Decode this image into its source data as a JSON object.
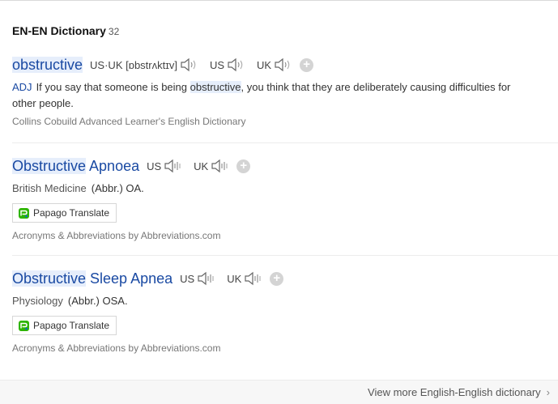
{
  "header": {
    "title": "EN-EN Dictionary",
    "count": "32"
  },
  "entries": [
    {
      "word_highlight": "obstructive",
      "word_rest": "",
      "pron_label": "US·UK [ɒbstrʌktɪv]",
      "us_label": "US",
      "uk_label": "UK",
      "pos": "ADJ",
      "def_before": "If you say that someone is being ",
      "def_highlight": "obstructive",
      "def_after": ", you think that they are deliberately causing difficulties for",
      "def_line2": "other people.",
      "source": "Collins Cobuild Advanced Learner's English Dictionary"
    },
    {
      "word_highlight": "Obstructive",
      "word_rest": " Apnoea",
      "us_label": "US",
      "uk_label": "UK",
      "category": "British Medicine",
      "abbr": "(Abbr.) OA.",
      "translate_label": "Papago Translate",
      "source": "Acronyms & Abbreviations by Abbreviations.com"
    },
    {
      "word_highlight": "Obstructive",
      "word_rest": " Sleep Apnea",
      "us_label": "US",
      "uk_label": "UK",
      "category": "Physiology",
      "abbr": "(Abbr.) OSA.",
      "translate_label": "Papago Translate",
      "source": "Acronyms & Abbreviations by Abbreviations.com"
    }
  ],
  "footer": {
    "view_more": "View more English-English dictionary",
    "chevron": "›"
  },
  "colors": {
    "link_blue": "#1a4aa3",
    "highlight_bg": "#e6eefb",
    "papago_green": "#2db400"
  }
}
